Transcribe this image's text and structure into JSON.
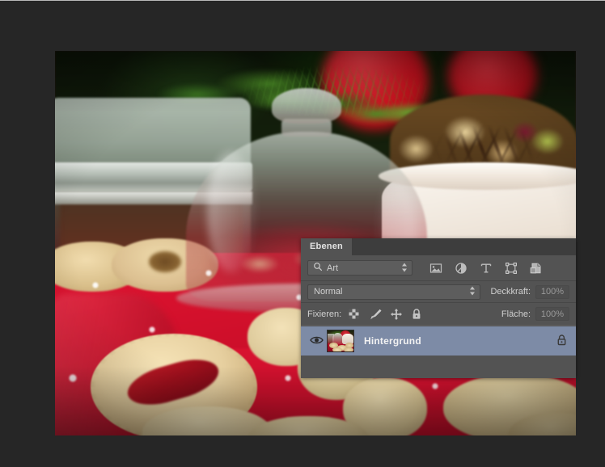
{
  "app": {
    "canvas_background": "#262626",
    "document_type": "photo-editor-canvas"
  },
  "photo": {
    "alt": "Christmas cookies with glass cloche, mason jar, white ceramic bowl and red star-patterned cloth",
    "subject": "christmas-cookies"
  },
  "panel": {
    "accent_selected": "#7d8ba6",
    "background": "#535353",
    "tabs": [
      {
        "label": "Ebenen",
        "active": true
      }
    ],
    "filter_row": {
      "search_icon": "magnifier-icon",
      "kind_value": "Art",
      "stepper_icon": "stepper-arrows-icon",
      "icons": [
        {
          "name": "pixel-layer-filter-icon",
          "label": "Pixel"
        },
        {
          "name": "adjustment-layer-filter-icon",
          "label": "Einstellung"
        },
        {
          "name": "type-layer-filter-icon",
          "label": "Text"
        },
        {
          "name": "shape-layer-filter-icon",
          "label": "Form"
        },
        {
          "name": "smart-object-filter-icon",
          "label": "Smartobjekt"
        }
      ]
    },
    "blend_row": {
      "blend_mode": "Normal",
      "stepper_icon": "stepper-arrows-icon",
      "opacity_label": "Deckkraft:",
      "opacity_value": "100%"
    },
    "lock_row": {
      "lock_label": "Fixieren:",
      "icons": [
        {
          "name": "lock-transparency-icon",
          "label": "Transparente Pixel fixieren"
        },
        {
          "name": "lock-image-pixels-icon",
          "label": "Bildpixel fixieren"
        },
        {
          "name": "lock-position-icon",
          "label": "Position fixieren"
        },
        {
          "name": "lock-all-icon",
          "label": "Alles fixieren"
        }
      ],
      "fill_label": "Fläche:",
      "fill_value": "100%"
    },
    "layers": [
      {
        "name": "Hintergrund",
        "visible": true,
        "locked": true,
        "selected": true,
        "visibility_icon": "eye-icon",
        "lock_icon": "padlock-icon",
        "thumbnail": "layer-thumbnail"
      }
    ]
  }
}
